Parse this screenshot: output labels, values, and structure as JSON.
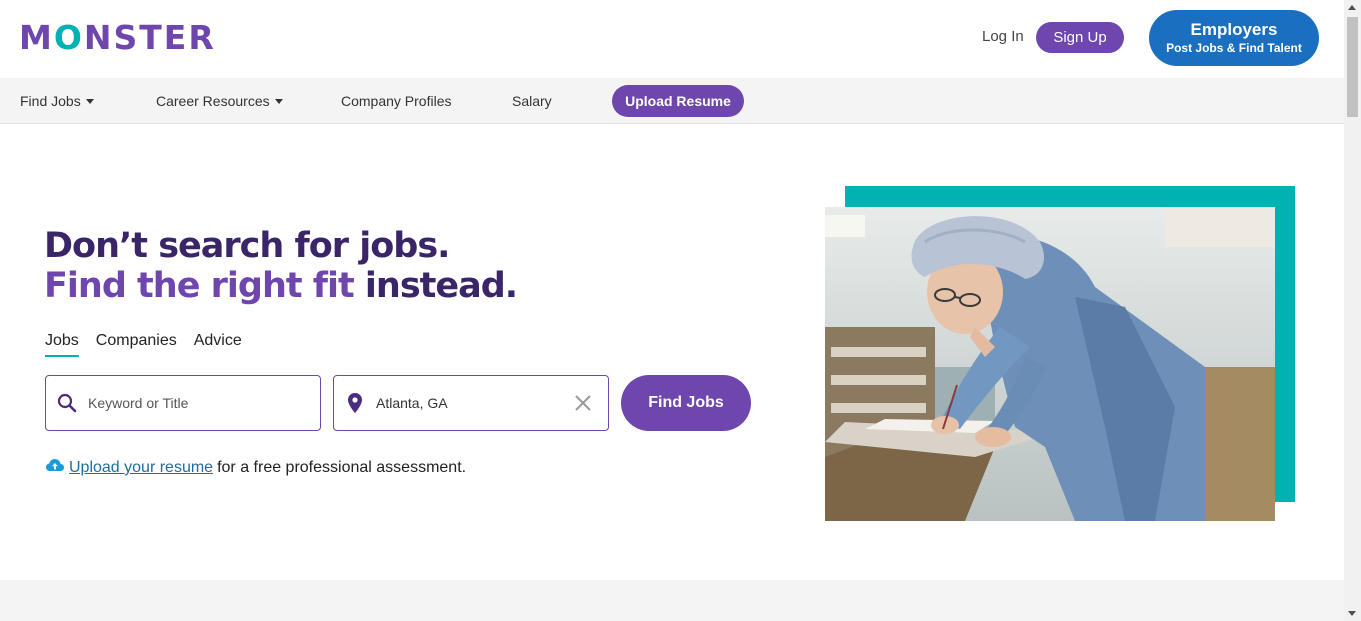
{
  "brand": {
    "logo_text_1": "M",
    "logo_text_o": "O",
    "logo_text_2": "NSTER"
  },
  "header": {
    "login_label": "Log In",
    "signup_label": "Sign Up",
    "employers_title": "Employers",
    "employers_subtitle": "Post Jobs & Find Talent"
  },
  "nav": {
    "items": [
      {
        "label": "Find Jobs",
        "has_dropdown": true
      },
      {
        "label": "Career Resources",
        "has_dropdown": true
      },
      {
        "label": "Company Profiles",
        "has_dropdown": false
      },
      {
        "label": "Salary",
        "has_dropdown": false
      }
    ],
    "upload_resume_label": "Upload Resume"
  },
  "hero": {
    "headline_line1": "Don’t search for jobs.",
    "headline_line2_accent": "Find the right fit",
    "headline_line2_rest": " instead.",
    "tabs": [
      {
        "label": "Jobs",
        "active": true
      },
      {
        "label": "Companies",
        "active": false
      },
      {
        "label": "Advice",
        "active": false
      }
    ],
    "search": {
      "keyword_placeholder": "Keyword or Title",
      "keyword_value": "",
      "location_value": "Atlanta, GA",
      "find_button_label": "Find Jobs"
    },
    "upload_link_text": "Upload your resume",
    "upload_suffix_text": "for a free professional assessment."
  },
  "colors": {
    "brand_purple": "#6e46ae",
    "brand_teal": "#00b2b2",
    "employer_blue": "#1a6fc0",
    "headline_dark": "#3a2568"
  },
  "icons": [
    "search-icon",
    "location-pin-icon",
    "clear-icon",
    "cloud-upload-icon",
    "chevron-down-icon"
  ]
}
